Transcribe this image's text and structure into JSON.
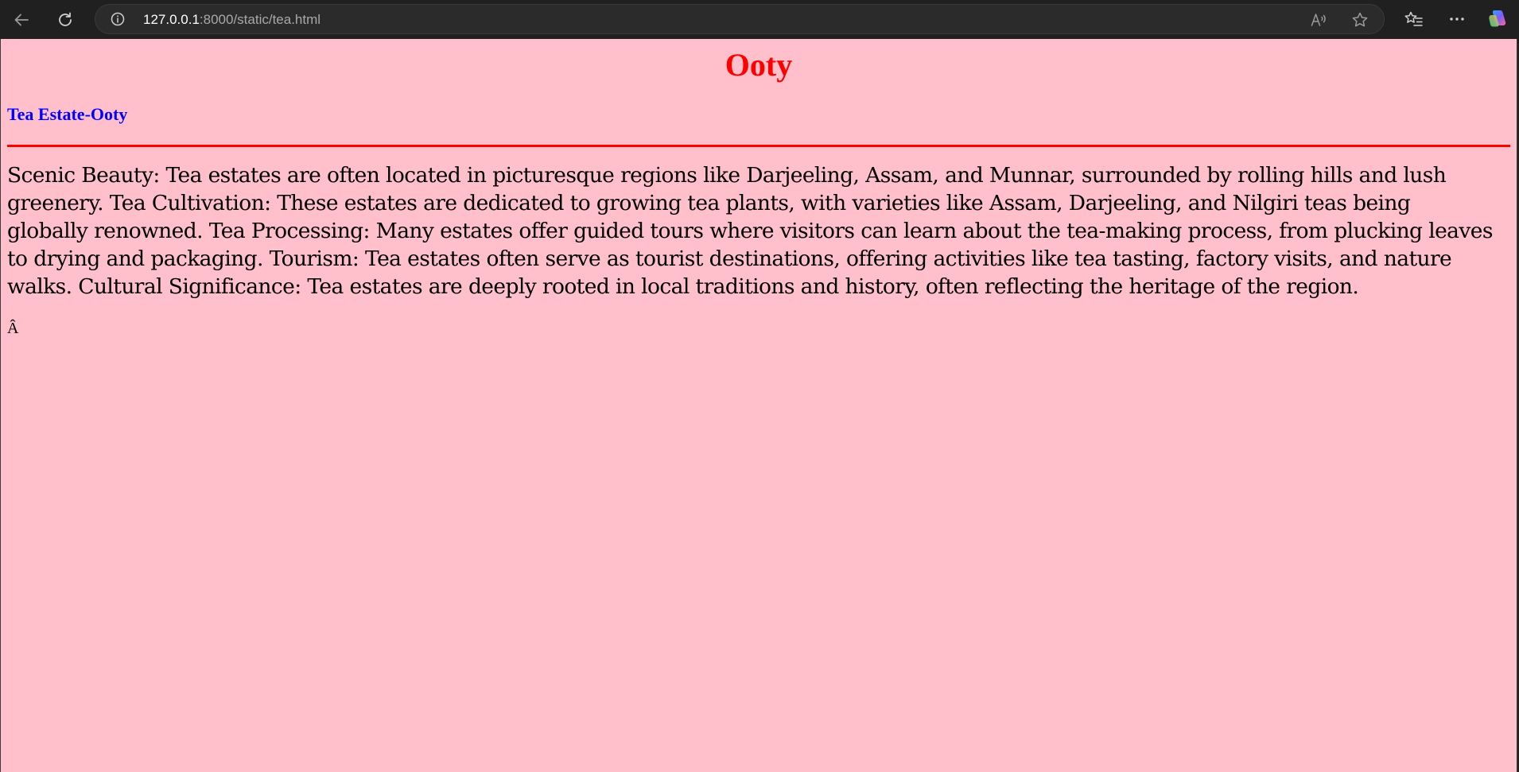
{
  "browser": {
    "url_host": "127.0.0.1",
    "url_path": ":8000/static/tea.html",
    "icons": {
      "back": "back-arrow-icon",
      "reload": "reload-icon",
      "info": "site-info-icon",
      "read_aloud": "read-aloud-icon",
      "favorite": "star-icon",
      "favorites": "favorites-icon",
      "more": "more-icon",
      "copilot": "copilot-icon"
    }
  },
  "page": {
    "background_color": "#ffc0cb",
    "title": "Ooty",
    "title_color": "#ff0000",
    "subtitle": "Tea Estate-Ooty",
    "subtitle_color": "#0000ff",
    "divider_color": "#ff0000",
    "body_text": "Scenic Beauty: Tea estates are often located in picturesque regions like Darjeeling, Assam, and Munnar, surrounded by rolling hills and lush greenery. Tea Cultivation: These estates are dedicated to growing tea plants, with varieties like Assam, Darjeeling, and Nilgiri teas being globally renowned. Tea Processing: Many estates offer guided tours where visitors can learn about the tea-making process, from plucking leaves to drying and packaging. Tourism: Tea estates often serve as tourist destinations, offering activities like tea tasting, factory visits, and nature walks. Cultural Significance: Tea estates are deeply rooted in local traditions and history, often reflecting the heritage of the region.",
    "stray_character": "Â"
  }
}
